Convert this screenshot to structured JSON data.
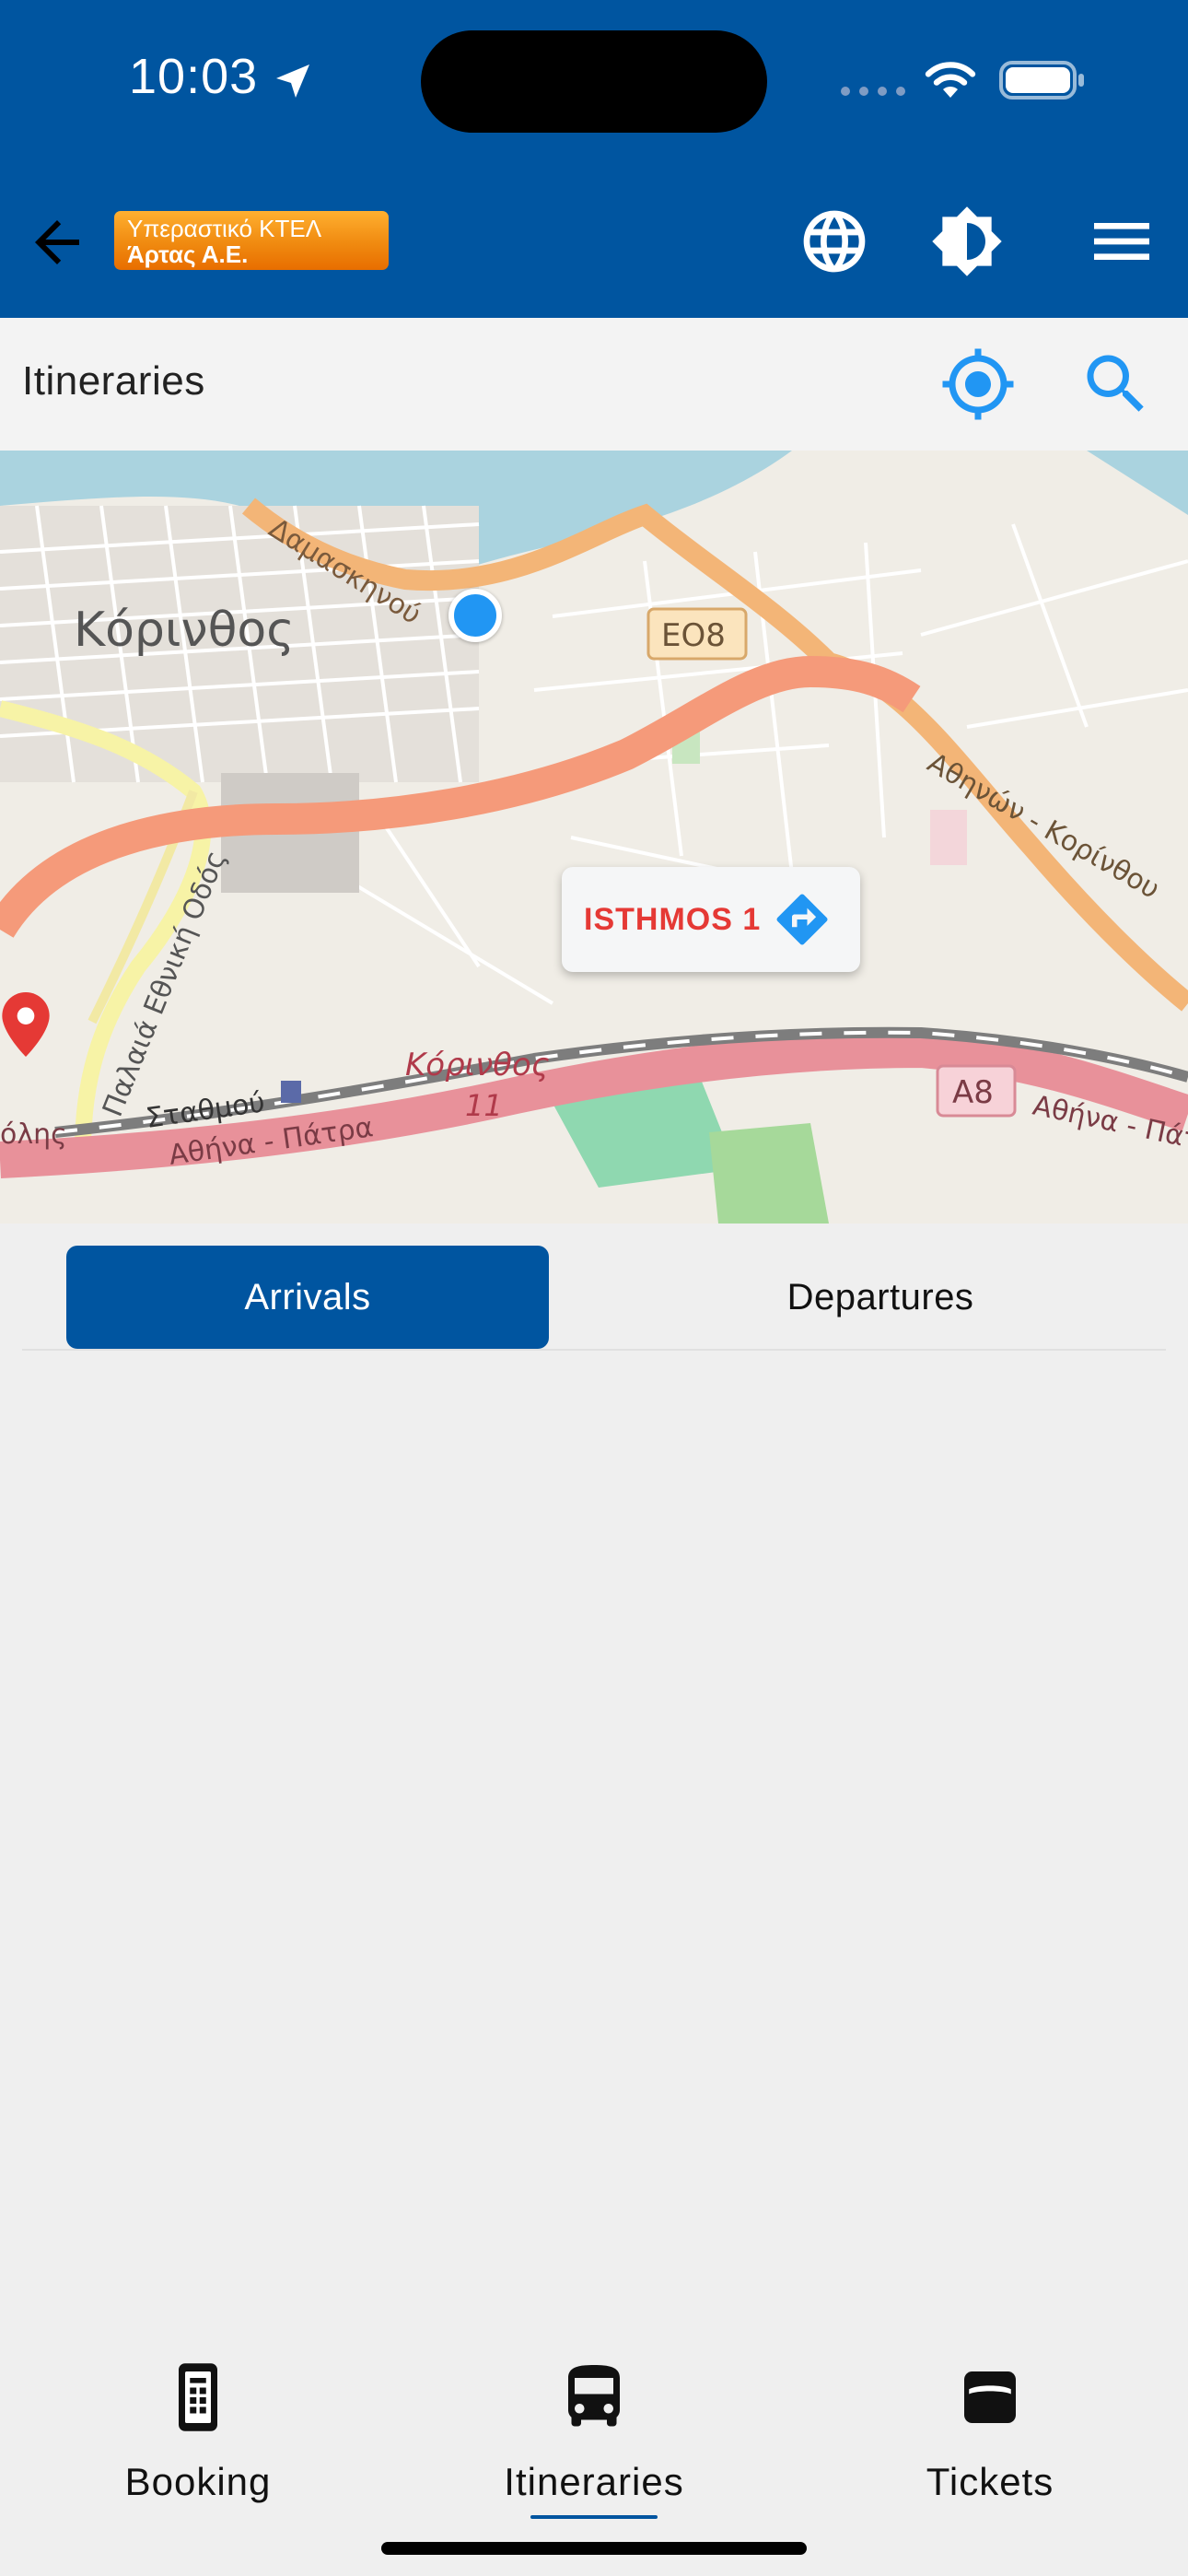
{
  "status_bar": {
    "time": "10:03"
  },
  "header": {
    "logo_line1": "Υπεραστικό ΚΤΕΛ",
    "logo_line2": "Άρτας Α.Ε."
  },
  "title_bar": {
    "title": "Itineraries"
  },
  "map": {
    "labels": {
      "city": "Κόρινθος",
      "street_damaskinou": "Δαμασκηνού",
      "road_eo8": "ΕΟ8",
      "road_athinon_korinthou": "Αθηνών - Κορίνθου",
      "road_palaia": "Παλαιά Εθνική Οδός",
      "road_stathmou": "Σταθμού",
      "road_olis": "όλης",
      "highway_athina_patra": "Αθήνα - Πάτρα",
      "highway_athina_patra_right": "Αθήνα - Πάτ",
      "exit_korinthos": "Κόρινθος",
      "exit_number": "11",
      "road_a8": "Α8"
    },
    "stop_name": "ISTHMOS 1"
  },
  "tabs": {
    "arrivals": "Arrivals",
    "departures": "Departures",
    "selected": "Arrivals"
  },
  "bottom_nav": {
    "booking": "Booking",
    "itineraries": "Itineraries",
    "tickets": "Tickets",
    "selected": "Itineraries"
  },
  "colors": {
    "primary": "#0055a0",
    "accent_blue": "#2196f3",
    "stop_red": "#e53935",
    "logo_orange": "#f08a10"
  }
}
